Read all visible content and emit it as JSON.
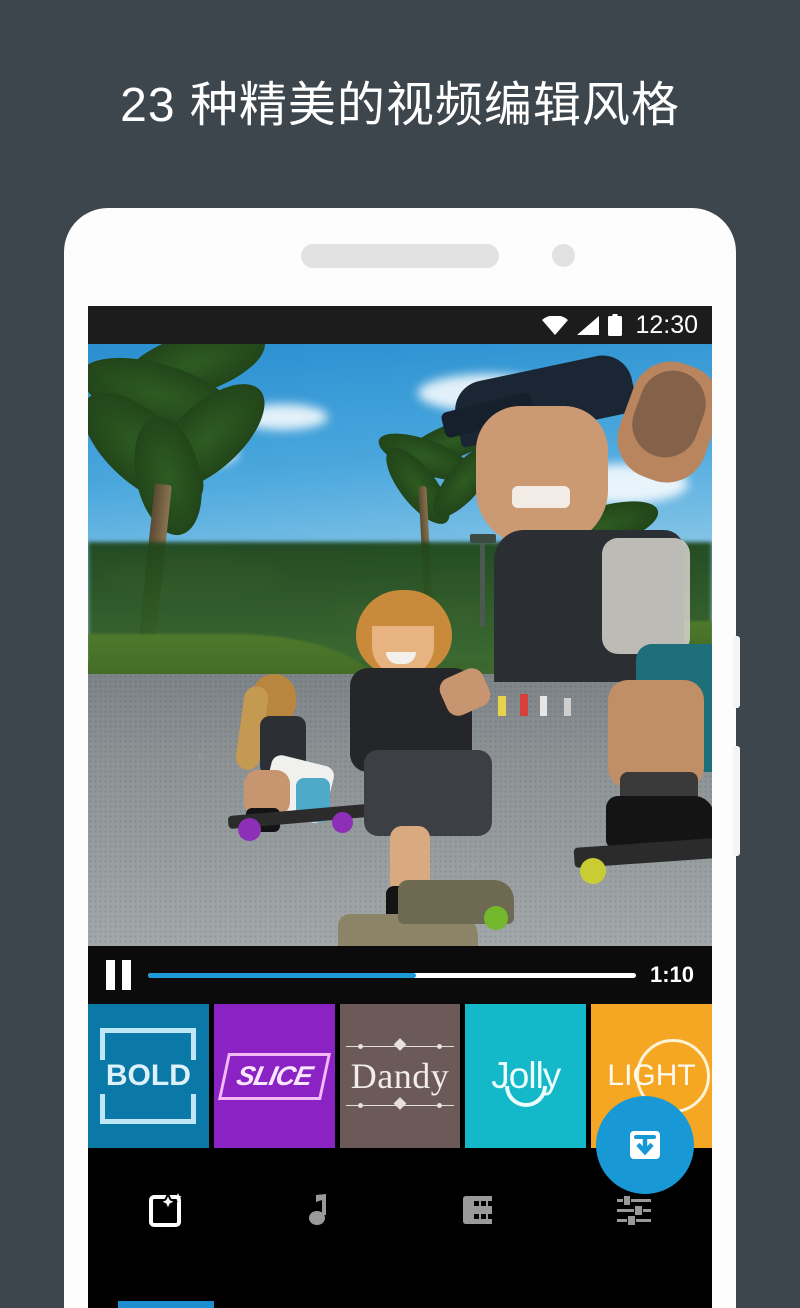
{
  "headline": "23 种精美的视频编辑风格",
  "background_color": "#3e464d",
  "phone": {
    "frame_color": "#fdfdfd",
    "speaker_name": "speaker-grille",
    "camera_name": "front-camera"
  },
  "status_bar": {
    "time": "12:30",
    "icons": [
      "wifi-icon",
      "signal-icon",
      "battery-icon"
    ]
  },
  "video": {
    "scene_description": "skateboarders on park road",
    "player": {
      "state_icon": "pause-icon",
      "duration": "1:10",
      "progress_percent": 55,
      "progress_color": "#1d9ad6"
    }
  },
  "styles": {
    "cards": [
      {
        "label": "BOLD",
        "color": "#0b79a8",
        "text_color": "#ddf1fa",
        "mark": "square-frame-mark"
      },
      {
        "label": "SLICE",
        "color": "#8b22c4",
        "text_color": "#fbe6fc",
        "mark": "slanted-box-mark"
      },
      {
        "label": "Dandy",
        "color": "#6b5a57",
        "text_color": "#f2ecea",
        "mark": "ornament-mark"
      },
      {
        "label": "Jolly",
        "color": "#13b9c9",
        "text_color": "#ecfcff",
        "mark": "smile-mark"
      },
      {
        "label": "LIGHT",
        "color": "#f5a623",
        "text_color": "#fffaf0",
        "mark": "circle-ring-mark"
      }
    ]
  },
  "fab": {
    "icon": "save-download-icon",
    "color": "#1899d6"
  },
  "bottom_nav": {
    "items": [
      {
        "icon": "styles-magic-icon",
        "active": true
      },
      {
        "icon": "music-note-icon",
        "active": false
      },
      {
        "icon": "film-strip-icon",
        "active": false
      },
      {
        "icon": "sliders-settings-icon",
        "active": false
      }
    ],
    "indicator_color": "#1d8fd1"
  }
}
